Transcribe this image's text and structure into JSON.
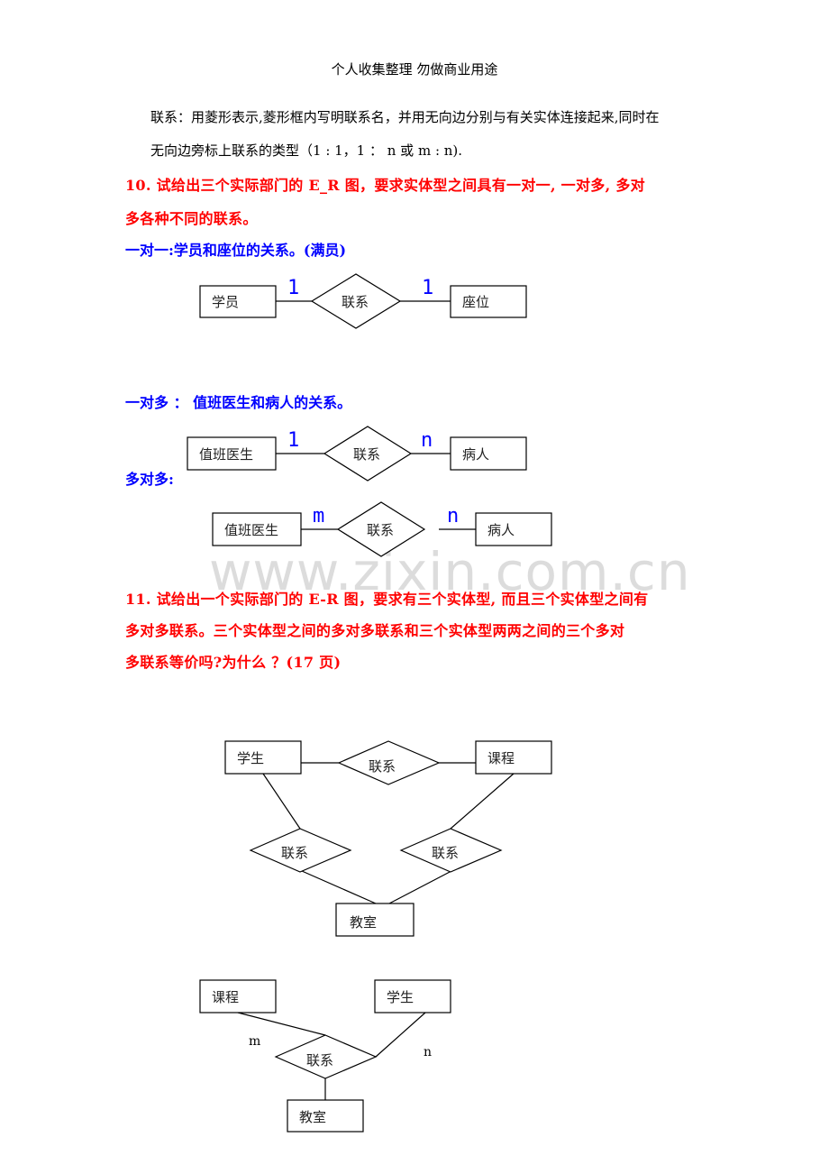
{
  "header": {
    "title": "个人收集整理 勿做商业用途"
  },
  "intro": {
    "line1": "联系：用菱形表示,菱形框内写明联系名，并用无向边分别与有关实体连接起来,同时在",
    "line2": "无向边旁标上联系的类型（1 : 1，1 ：  n 或 m : n)."
  },
  "q10": {
    "line1": "10. 试给出三个实际部门的 E_R 图，要求实体型之间具有一对一, 一对多, 多对",
    "line2": "多各种不同的联系。",
    "one_to_one_heading": "一对一:学员和座位的关系。(满员)",
    "one_to_many_heading": "一对多  ：  值班医生和病人的关系。",
    "many_to_many_heading": "多对多:"
  },
  "diagrams": {
    "one_to_one": {
      "entity_left": "学员",
      "relationship": "联系",
      "entity_right": "座位",
      "card_left": "1",
      "card_right": "1"
    },
    "one_to_many": {
      "entity_left": "值班医生",
      "relationship": "联系",
      "entity_right": "病人",
      "card_left": "1",
      "card_right": "n"
    },
    "many_to_many": {
      "entity_left": "值班医生",
      "relationship": "联系",
      "entity_right": "病人",
      "card_left": "m",
      "card_right": "n"
    },
    "binary_three": {
      "entity_student": "学生",
      "entity_course": "课程",
      "entity_classroom": "教室",
      "rel_top": "联系",
      "rel_left": "联系",
      "rel_right": "联系"
    },
    "ternary": {
      "entity_course": "课程",
      "entity_student": "学生",
      "entity_classroom": "教室",
      "relationship": "联系",
      "card_m": "m",
      "card_n": "n"
    }
  },
  "watermark": "www.zixin.com.cn",
  "q11": {
    "line1": "11. 试给出一个实际部门的 E-R 图，要求有三个实体型, 而且三个实体型之间有",
    "line2": "多对多联系。三个实体型之间的多对多联系和三个实体型两两之间的三个多对",
    "line3": "多联系等价吗?为什么 ？(17 页)"
  }
}
